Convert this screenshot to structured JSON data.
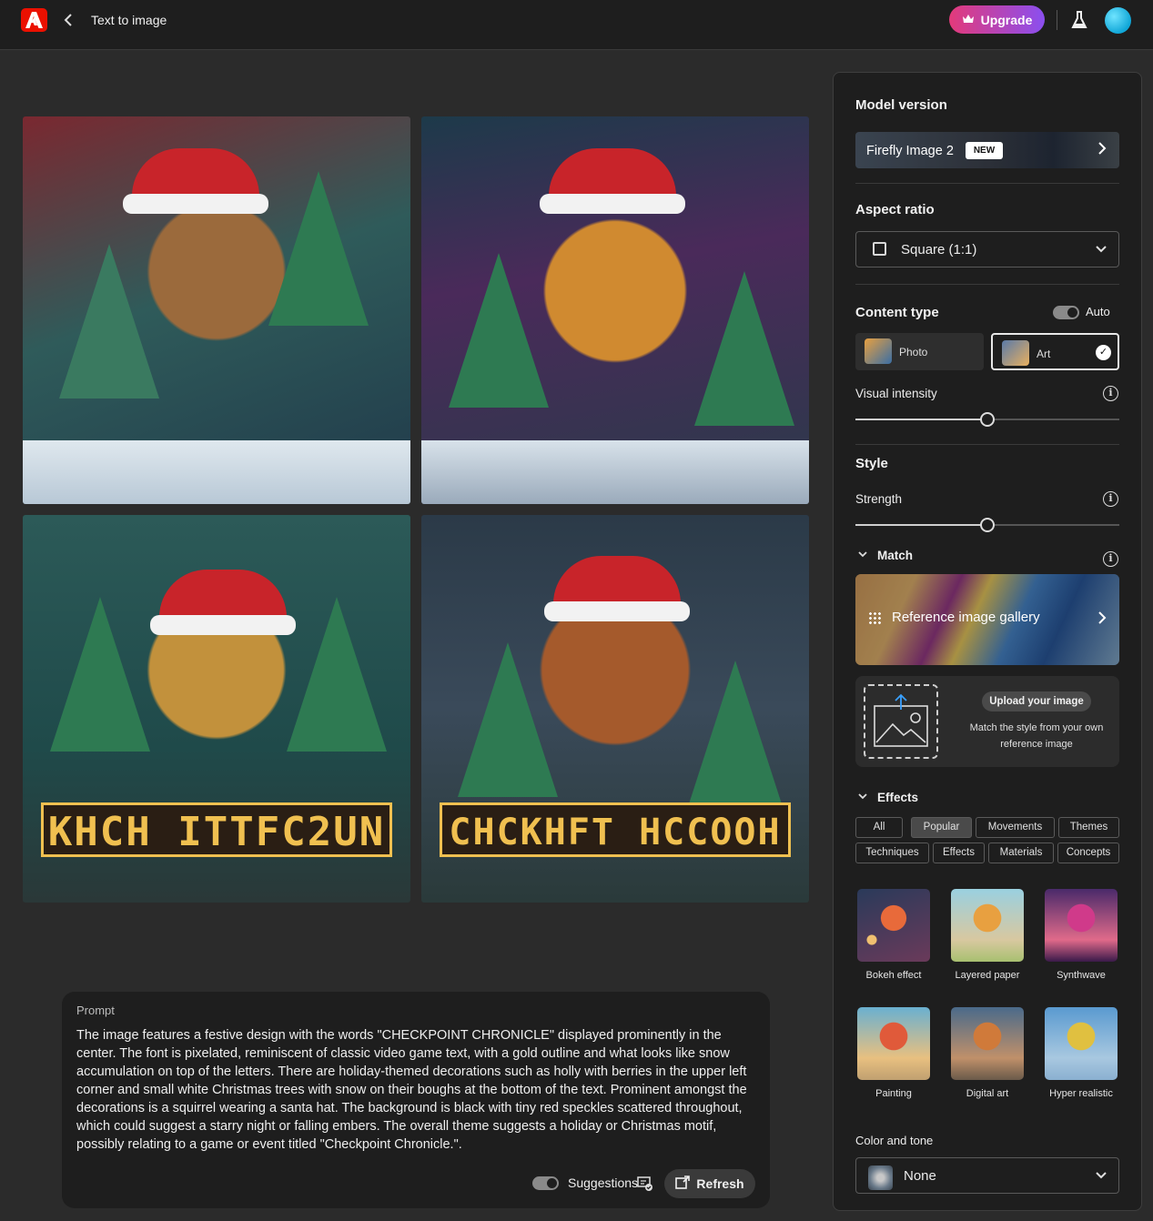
{
  "header": {
    "title": "Text to image",
    "upgrade_label": "Upgrade"
  },
  "prompt": {
    "label": "Prompt",
    "text": "The image features a festive design with the words \"CHECKPOINT CHRONICLE\" displayed prominently in the center. The font is pixelated, reminiscent of classic video game text, with a gold outline and what looks like snow accumulation on top of the letters. There are holiday-themed decorations such as holly with berries in the upper left corner and small white Christmas trees with snow on their boughs at the bottom of the text. Prominent amongst the decorations is a squirrel wearing a santa hat. The background is black with tiny red speckles scattered throughout, which could suggest a starry night or falling embers. The overall theme suggests a holiday or Christmas motif, possibly relating to a game or event titled \"Checkpoint Chronicle.\".",
    "suggestions_label": "Suggestions",
    "refresh_label": "Refresh"
  },
  "images": {
    "tile3_text": "KHCH ITTFC2UN",
    "tile4_text": "CHCKHFT HCCOOH"
  },
  "panel": {
    "model_version_title": "Model version",
    "model_name": "Firefly Image 2",
    "model_badge": "NEW",
    "aspect_ratio_title": "Aspect ratio",
    "aspect_ratio_value": "Square (1:1)",
    "content_type_title": "Content type",
    "auto_label": "Auto",
    "content_types": [
      {
        "label": "Photo",
        "selected": false
      },
      {
        "label": "Art",
        "selected": true
      }
    ],
    "visual_intensity_label": "Visual intensity",
    "visual_intensity_value": 0.5,
    "style_title": "Style",
    "strength_label": "Strength",
    "strength_value": 0.5,
    "match_label": "Match",
    "reference_gallery_label": "Reference image gallery",
    "upload_button": "Upload your image",
    "upload_desc": "Match the style from your own reference image",
    "effects_label": "Effects",
    "effect_tabs": [
      "All",
      "Popular",
      "Movements",
      "Themes",
      "Techniques",
      "Effects",
      "Materials",
      "Concepts"
    ],
    "active_effect_tab": "Popular",
    "effects": [
      {
        "label": "Bokeh effect"
      },
      {
        "label": "Layered paper"
      },
      {
        "label": "Synthwave"
      },
      {
        "label": "Painting"
      },
      {
        "label": "Digital art"
      },
      {
        "label": "Hyper realistic"
      }
    ],
    "color_tone_label": "Color and tone",
    "color_tone_value": "None"
  },
  "colors": {
    "background": "#2b2b2b",
    "panel": "#1e1e1e",
    "logo": "#eb1000",
    "upgrade_gradient_start": "#e33a7a",
    "upgrade_gradient_end": "#8a4ff0"
  }
}
